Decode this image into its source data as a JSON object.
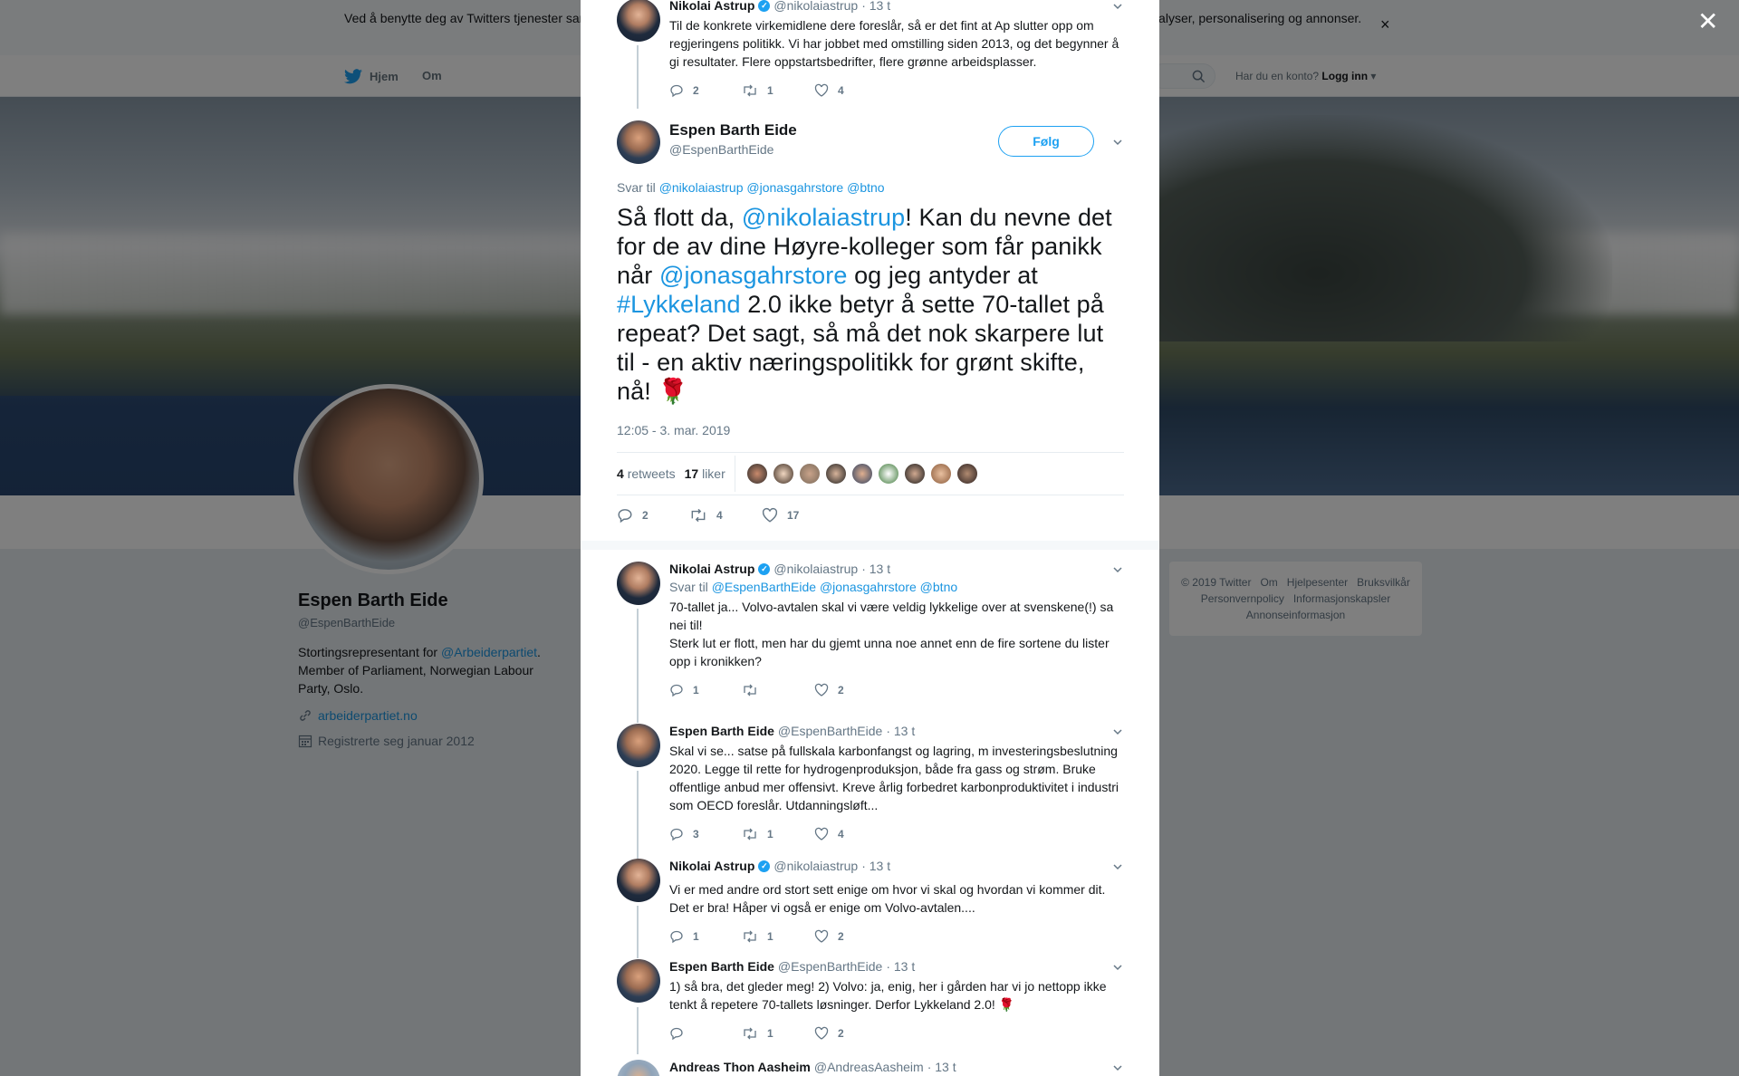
{
  "cookie": {
    "text": "Ved å benytte deg av Twitters tjenester samtykker du i bruken av informasjonskapsler. Twitter og partnere benytter informasjonskapsler til bl.a. analyser, personalisering og annonser.",
    "close": "×"
  },
  "topnav": {
    "home": "Hjem",
    "about": "Om",
    "login_prompt": "Har du en konto?",
    "login": "Logg inn"
  },
  "profile": {
    "name": "Espen Barth Eide",
    "handle": "@EspenBarthEide",
    "bio_prefix": "Stortingsrepresentant for ",
    "bio_link": "@Arbeiderpartiet",
    "bio_suffix": ". Member of Parliament, Norwegian Labour Party, Oslo.",
    "website": "arbeiderpartiet.no",
    "joined": "Registrerte seg januar 2012"
  },
  "footer": {
    "line1": [
      "© 2019 Twitter",
      "Om",
      "Hjelpesenter",
      "Bruksvilkår"
    ],
    "line2": [
      "Personvernpolicy",
      "Informasjonskapsler"
    ],
    "line3": [
      "Annonseinformasjon"
    ]
  },
  "overlay_close": "✕",
  "parent_tweet": {
    "name": "Nikolai Astrup",
    "handle": "@nikolaiastrup",
    "time": "· 13 t",
    "text": "Til de konkrete virkemidlene dere foreslår, så er det fint at Ap slutter opp om regjeringens politikk. Vi har jobbet med omstilling siden 2013, og det begynner å gi resultater. Flere oppstartsbedrifter, flere grønne arbeidsplasser.",
    "replies": "2",
    "retweets": "1",
    "likes": "4"
  },
  "main_tweet": {
    "name": "Espen Barth Eide",
    "handle": "@EspenBarthEide",
    "follow": "Følg",
    "reply_label": "Svar til",
    "reply_to": "@nikolaiastrup @jonasgahrstore @btno",
    "text_1": "Så flott da, ",
    "mention_1": "@nikolaiastrup",
    "text_2": "! Kan du nevne det for de av dine Høyre-kolleger som får panikk når ",
    "mention_2": "@jonasgahrstore",
    "text_3": " og jeg antyder at ",
    "hashtag": "#Lykkeland",
    "text_4": " 2.0 ikke betyr å sette 70-tallet på repeat? Det sagt, så må det nok skarpere lut til - en aktiv næringspolitikk for grønt skifte, nå! 🌹",
    "timestamp": "12:05 - 3. mar. 2019",
    "retweets_count": "4",
    "retweets_label": "retweets",
    "likes_count": "17",
    "likes_label": "liker",
    "replies": "2",
    "retweets": "4",
    "likes": "17"
  },
  "replies": [
    {
      "name": "Nikolai Astrup",
      "handle": "@nikolaiastrup",
      "time": "· 13 t",
      "reply_label": "Svar til",
      "reply_to": "@EspenBarthEide @jonasgahrstore @btno",
      "text": "70-tallet ja... Volvo-avtalen skal vi være veldig lykkelige over at svenskene(!) sa nei til!",
      "text2": "Sterk lut er flott, men har du gjemt unna noe annet enn de fire sortene du lister opp i kronikken?",
      "replies": "1",
      "retweets": "",
      "likes": "2"
    },
    {
      "name": "Espen Barth Eide",
      "handle": "@EspenBarthEide",
      "time": "· 13 t",
      "text": "Skal vi se... satse på fullskala karbonfangst og lagring, m investeringsbeslutning 2020. Legge til rette for hydrogenproduksjon, både fra gass og strøm. Bruke offentlige anbud mer offensivt. Kreve årlig forbedret karbonproduktivitet i industri som OECD foreslår. Utdanningsløft...",
      "replies": "3",
      "retweets": "1",
      "likes": "4"
    },
    {
      "name": "Nikolai Astrup",
      "handle": "@nikolaiastrup",
      "time": "· 13 t",
      "text": "Vi er med andre ord stort sett enige om hvor vi skal og hvordan vi kommer dit. Det er bra! Håper vi også er enige om Volvo-avtalen....",
      "replies": "1",
      "retweets": "1",
      "likes": "2"
    },
    {
      "name": "Espen Barth Eide",
      "handle": "@EspenBarthEide",
      "time": "· 13 t",
      "text": "1) så bra, det gleder meg! 2) Volvo: ja, enig, her i gården har vi jo nettopp ikke tenkt å repetere 70-tallets løsninger. Derfor Lykkeland 2.0! 🌹",
      "replies": "",
      "retweets": "1",
      "likes": "2"
    },
    {
      "name": "Andreas Thon Aasheim",
      "handle": "@AndreasAasheim",
      "time": "· 13 t"
    }
  ],
  "colors": {
    "accent": "#1da1f2",
    "link": "#1b95e0",
    "muted": "#657786"
  },
  "icons": [
    "twitter-bird-icon",
    "search-icon",
    "reply-icon",
    "retweet-icon",
    "heart-icon",
    "chevron-down-icon",
    "link-icon",
    "calendar-icon",
    "verified-icon",
    "close-icon"
  ]
}
